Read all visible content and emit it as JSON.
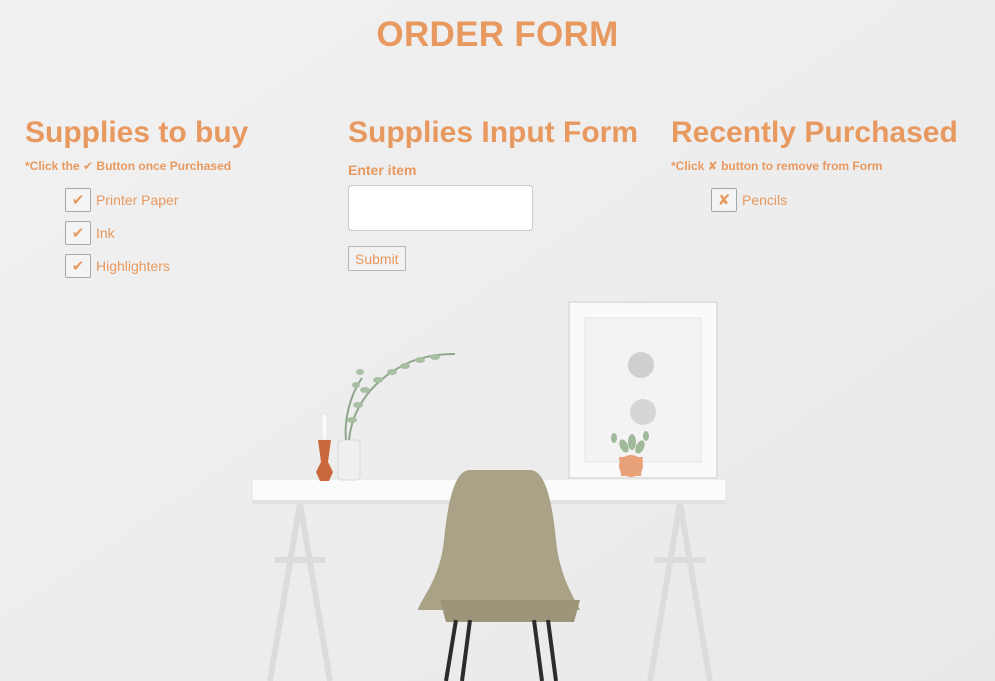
{
  "page": {
    "title": "ORDER FORM"
  },
  "supplies": {
    "heading": "Supplies to buy",
    "hint": "*Click the ✔ Button once Purchased",
    "check_glyph": "✔",
    "items": [
      {
        "label": "Printer Paper"
      },
      {
        "label": "Ink"
      },
      {
        "label": "Highlighters"
      }
    ]
  },
  "input_form": {
    "heading": "Supplies Input Form",
    "field_label": "Enter item",
    "input_value": "",
    "submit_label": "Submit"
  },
  "recent": {
    "heading": "Recently Purchased",
    "hint": "*Click ✘ button to remove from Form",
    "remove_glyph": "✘",
    "items": [
      {
        "label": "Pencils"
      }
    ]
  },
  "colors": {
    "accent": "#e8995f",
    "background": "#efefef"
  },
  "background_image": {
    "icon": "desk-chair-scene"
  }
}
